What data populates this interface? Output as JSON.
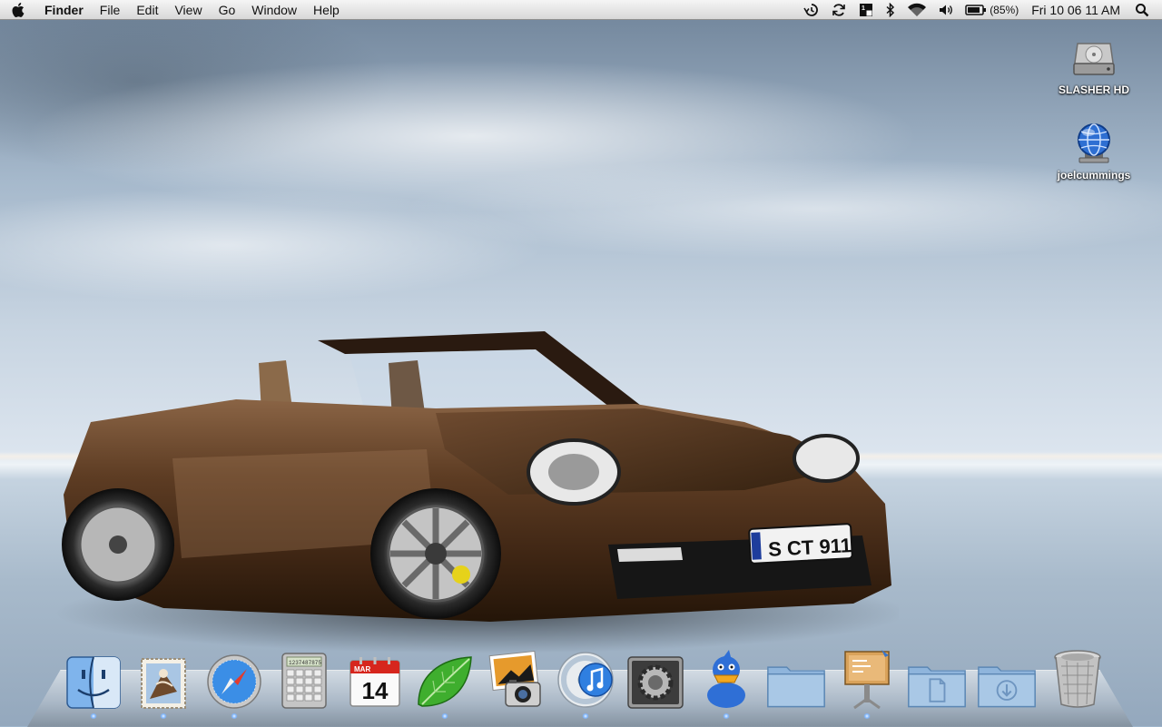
{
  "menubar": {
    "apple_icon": "apple-logo-icon",
    "app_name": "Finder",
    "menus": [
      "File",
      "Edit",
      "View",
      "Go",
      "Window",
      "Help"
    ],
    "status_icons": [
      "time-machine-icon",
      "sync-icon",
      "spaces-icon",
      "bluetooth-icon",
      "wifi-icon",
      "volume-icon",
      "battery-icon"
    ],
    "battery_percent": "(85%)",
    "clock": "Fri 10 06 11 AM",
    "spotlight_icon": "spotlight-search-icon"
  },
  "desktop": {
    "icons": [
      {
        "label": "SLASHER HD",
        "icon": "hard-drive-icon"
      },
      {
        "label": "joelcummings",
        "icon": "network-share-icon"
      }
    ]
  },
  "wallpaper": {
    "license_plate": "S CT 911",
    "plate_country": "D"
  },
  "dock": {
    "items": [
      {
        "icon": "finder-icon"
      },
      {
        "icon": "mail-icon"
      },
      {
        "icon": "safari-icon"
      },
      {
        "icon": "calculator-icon",
        "display": "1237487875"
      },
      {
        "icon": "ical-icon",
        "month": "MAR",
        "day": "14"
      },
      {
        "icon": "leaf-icon"
      },
      {
        "icon": "iphoto-icon"
      },
      {
        "icon": "itunes-icon"
      },
      {
        "icon": "system-preferences-icon"
      },
      {
        "icon": "adium-duck-icon"
      },
      {
        "icon": "applications-folder-icon"
      },
      {
        "icon": "keynote-icon"
      },
      {
        "icon": "documents-folder-icon"
      },
      {
        "icon": "downloads-folder-icon"
      },
      {
        "icon": "trash-icon"
      }
    ]
  },
  "colors": {
    "menubar": "#e6e6e6",
    "sky": "#a6b9cc",
    "car_body": "#5a3a22",
    "dock_light": "#7fb6ff"
  }
}
